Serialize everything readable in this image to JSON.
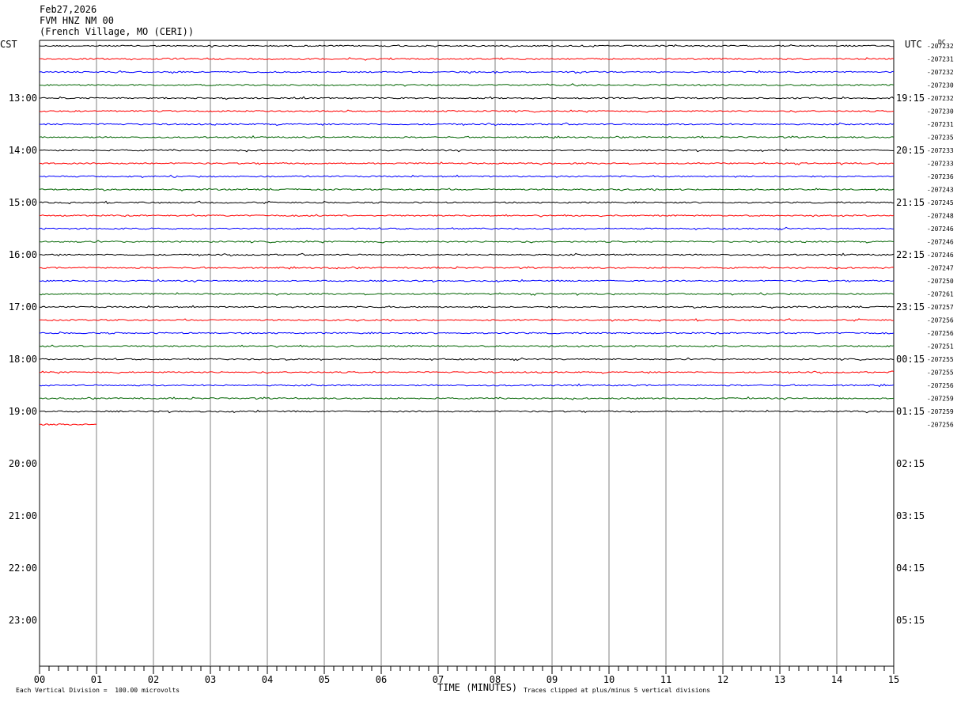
{
  "header": {
    "date": "Feb27,2026",
    "station": "FVM HNZ NM 00",
    "location": "(French Village, MO (CERI))"
  },
  "left_tz": "CST",
  "right_tz": "UTC",
  "corner_mark": "DC",
  "footer": {
    "scale_note": "Each Vertical Division =  100.00 microvolts",
    "xlabel": "TIME (MINUTES)",
    "clip_note": "Traces clipped at plus/minus 5 vertical divisions"
  },
  "chart_data": {
    "type": "line",
    "xlabel": "TIME (MINUTES)",
    "xlim": [
      0,
      15
    ],
    "x_ticks": [
      "00",
      "01",
      "02",
      "03",
      "04",
      "05",
      "06",
      "07",
      "08",
      "09",
      "10",
      "11",
      "12",
      "13",
      "14",
      "15"
    ],
    "left_hour_labels": [
      "13:00",
      "14:00",
      "15:00",
      "16:00",
      "17:00",
      "18:00",
      "19:00",
      "20:00",
      "21:00",
      "22:00",
      "23:00"
    ],
    "right_hour_labels": [
      "19:15",
      "20:15",
      "21:15",
      "22:15",
      "23:15",
      "00:15",
      "01:15",
      "02:15",
      "03:15",
      "04:15",
      "05:15"
    ],
    "rows_per_hour": 4,
    "trace_colors": [
      "#000000",
      "#ff0000",
      "#0000ff",
      "#006400"
    ],
    "grid": true,
    "trace_dc_offsets": [
      "-207232",
      "-207231",
      "-207232",
      "-207230",
      "-207232",
      "-207230",
      "-207231",
      "-207235",
      "-207233",
      "-207233",
      "-207236",
      "-207243",
      "-207245",
      "-207248",
      "-207246",
      "-207246",
      "-207246",
      "-207247",
      "-207250",
      "-207261",
      "-207257",
      "-207256",
      "-207256",
      "-207251",
      "-207255",
      "-207255",
      "-207256",
      "-207259",
      "-207259",
      "-207256"
    ],
    "trace_count": 30,
    "last_trace_end_minute": 1.0
  }
}
